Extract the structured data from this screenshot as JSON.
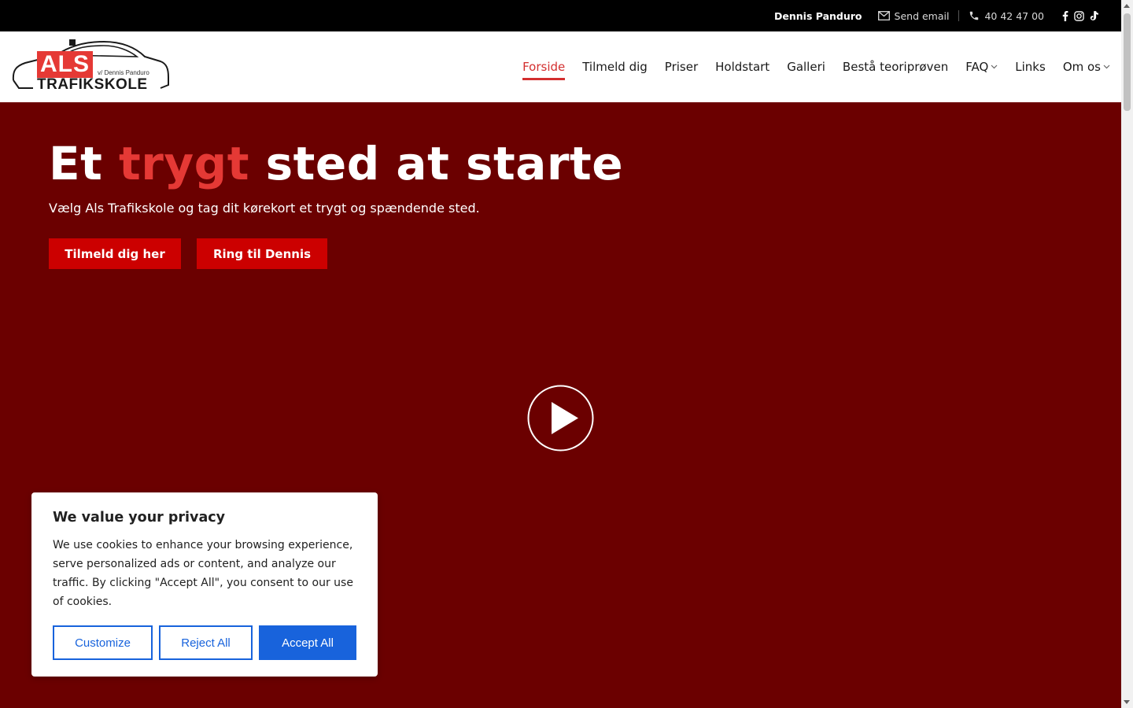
{
  "topbar": {
    "owner": "Dennis Panduro",
    "email_label": "Send email",
    "phone": "40 42 47 00",
    "social_icons": [
      "facebook-icon",
      "instagram-icon",
      "tiktok-icon"
    ]
  },
  "logo": {
    "brand": "ALS",
    "sub": "v/ Dennis Panduro",
    "name": "TRAFIKSKOLE"
  },
  "nav": {
    "items": [
      {
        "label": "Forside",
        "active": true
      },
      {
        "label": "Tilmeld dig"
      },
      {
        "label": "Priser"
      },
      {
        "label": "Holdstart"
      },
      {
        "label": "Galleri"
      },
      {
        "label": "Bestå teoriprøven"
      },
      {
        "label": "FAQ",
        "dropdown": true
      },
      {
        "label": "Links"
      },
      {
        "label": "Om os",
        "dropdown": true
      }
    ]
  },
  "hero": {
    "title_pre": "Et ",
    "title_accent": "trygt",
    "title_post": " sted at starte",
    "subtitle": "Vælg Als Trafikskole og tag dit kørekort et trygt og spændende sted.",
    "primary_button": "Tilmeld dig her",
    "secondary_button": "Ring til Dennis"
  },
  "cookie": {
    "title": "We value your privacy",
    "body": "We use cookies to enhance your browsing experience, serve personalized ads or content, and analyze our traffic. By clicking \"Accept All\", you consent to our use of cookies.",
    "customize": "Customize",
    "reject": "Reject All",
    "accept": "Accept All"
  },
  "colors": {
    "topbar_bg": "#000000",
    "hero_bg": "#6b0000",
    "accent_red": "#e53935",
    "button_red": "#cc0000",
    "cookie_blue": "#1863dc"
  }
}
